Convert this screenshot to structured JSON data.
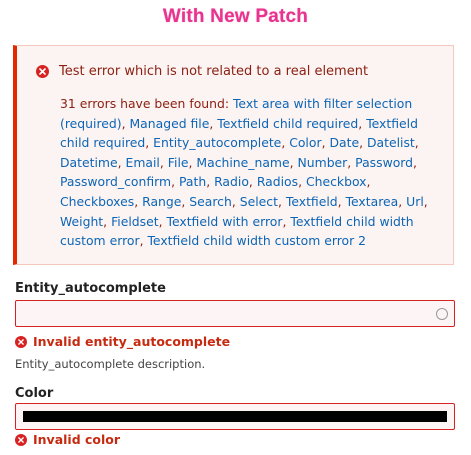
{
  "banner": "With New Patch",
  "error_summary": {
    "message": "Test error which is not related to a real element",
    "count_prefix": "31 errors have been found: ",
    "links": [
      "Text area with filter selection (required)",
      "Managed file",
      "Textfield child required",
      "Textfield child required",
      "Entity_autocomplete",
      "Color",
      "Date",
      "Datelist",
      "Datetime",
      "Email",
      "File",
      "Machine_name",
      "Number",
      "Password",
      "Password_confirm",
      "Path",
      "Radio",
      "Radios",
      "Checkbox",
      "Checkboxes",
      "Range",
      "Search",
      "Select",
      "Textfield",
      "Textarea",
      "Url",
      "Weight",
      "Fieldset",
      "Textfield with error",
      "Textfield child width custom error",
      "Textfield child width custom error 2"
    ],
    "separator": ", "
  },
  "entity_field": {
    "label": "Entity_autocomplete",
    "value": "",
    "error": "Invalid entity_autocomplete",
    "description": "Entity_autocomplete description."
  },
  "color_field": {
    "label": "Color",
    "value": "#000000",
    "error": "Invalid color"
  },
  "colors": {
    "banner": "#e8338f",
    "error_border": "#e32700",
    "error_text": "#8b1f11",
    "link": "#0d65b5",
    "invalid": "#c62b11"
  }
}
